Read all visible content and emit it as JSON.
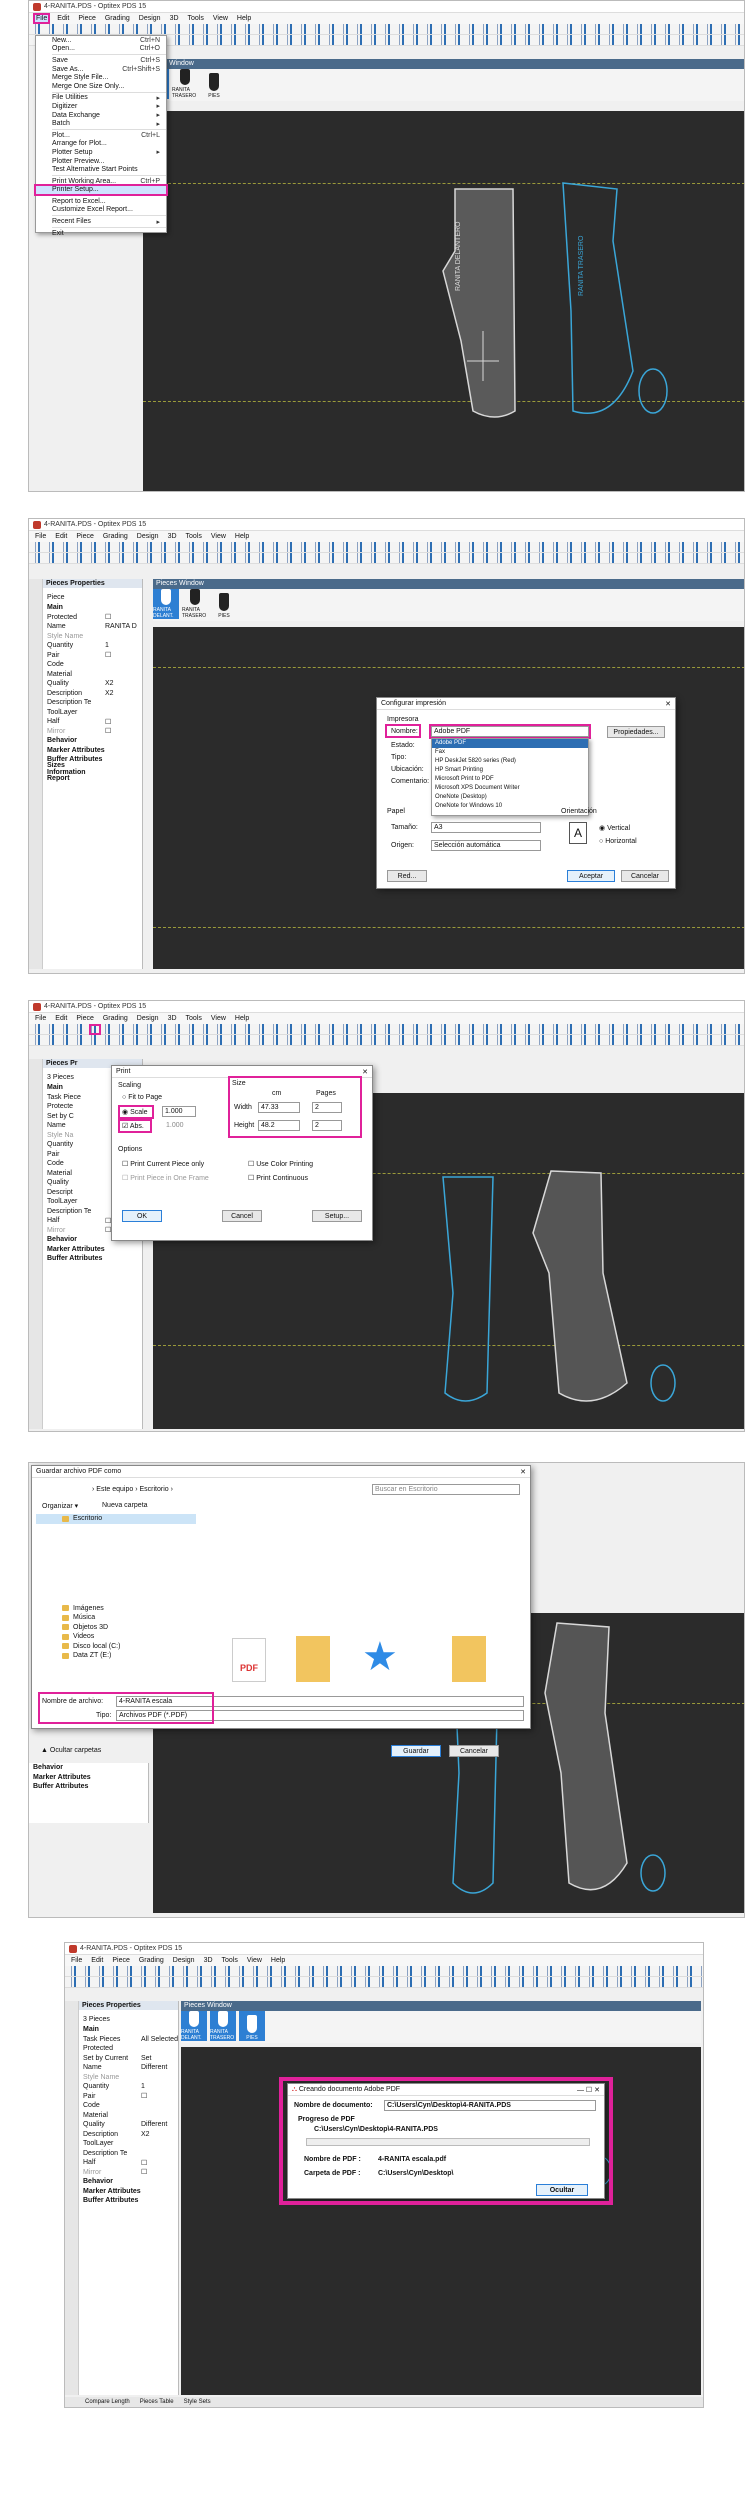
{
  "app_title": "4-RANITA.PDS - Optitex PDS 15",
  "menubar": [
    "File",
    "Edit",
    "Piece",
    "Grading",
    "Design",
    "3D",
    "Tools",
    "View",
    "Help"
  ],
  "pieces_window": "Pieces Window",
  "piece_labels": {
    "delantero": "RANITA DELANTERO",
    "trasero": "RANITA TRASERO"
  },
  "thumbs": [
    "RANITA DELANT.",
    "RANITA TRASERO",
    "PIES"
  ],
  "side_tabs": [
    "Slider",
    "Model Manager",
    "3D Properties"
  ],
  "file_menu": [
    {
      "label": "New...",
      "sc": "Ctrl+N"
    },
    {
      "label": "Open...",
      "sc": "Ctrl+O"
    },
    {
      "label": "Save",
      "sc": "Ctrl+S"
    },
    {
      "label": "Save As...",
      "sc": "Ctrl+Shift+S"
    },
    {
      "label": "Merge Style File...",
      "sc": ""
    },
    {
      "label": "Merge One Size Only...",
      "sc": ""
    },
    {
      "label": "File Utilities",
      "sc": "▸"
    },
    {
      "label": "Digitizer",
      "sc": "▸"
    },
    {
      "label": "Data Exchange",
      "sc": "▸"
    },
    {
      "label": "Batch",
      "sc": "▸"
    },
    {
      "label": "Plot...",
      "sc": "Ctrl+L"
    },
    {
      "label": "Arrange for Plot...",
      "sc": ""
    },
    {
      "label": "Plotter Setup",
      "sc": "▸"
    },
    {
      "label": "Plotter Preview...",
      "sc": ""
    },
    {
      "label": "Test Alternative Start Points",
      "sc": ""
    },
    {
      "label": "Print Working Area...",
      "sc": "Ctrl+P"
    },
    {
      "label": "Printer Setup...",
      "sc": ""
    },
    {
      "label": "Report to Excel...",
      "sc": ""
    },
    {
      "label": "Customize Excel Report...",
      "sc": ""
    },
    {
      "label": "Recent Files",
      "sc": "▸"
    },
    {
      "label": "Exit",
      "sc": ""
    }
  ],
  "props1": {
    "title": "Pieces Properties",
    "section": "Piece",
    "rows": [
      {
        "k": "Main",
        "v": "",
        "t": "b"
      },
      {
        "k": "Protected",
        "v": "☐",
        "t": ""
      },
      {
        "k": "Name",
        "v": "RANITA D",
        "t": ""
      },
      {
        "k": "Style Name",
        "v": "",
        "t": "g"
      },
      {
        "k": "Quantity",
        "v": "1",
        "t": ""
      },
      {
        "k": "Pair",
        "v": "☐",
        "t": ""
      },
      {
        "k": "Code",
        "v": "",
        "t": ""
      },
      {
        "k": "Material",
        "v": "",
        "t": ""
      },
      {
        "k": "Quality",
        "v": "X2",
        "t": ""
      },
      {
        "k": "Description",
        "v": "X2",
        "t": ""
      },
      {
        "k": "Description Te",
        "v": "",
        "t": ""
      },
      {
        "k": "ToolLayer",
        "v": "",
        "t": ""
      },
      {
        "k": "Half",
        "v": "☐",
        "t": ""
      },
      {
        "k": "Mirror",
        "v": "☐",
        "t": "g"
      },
      {
        "k": "Behavior",
        "v": "",
        "t": "b"
      },
      {
        "k": "Marker Attributes",
        "v": "",
        "t": "b"
      },
      {
        "k": "Buffer Attributes",
        "v": "",
        "t": "b"
      },
      {
        "k": "Sizes Information",
        "v": "",
        "t": "b"
      },
      {
        "k": "Report",
        "v": "",
        "t": "b"
      }
    ]
  },
  "config_dialog": {
    "title": "Configurar impresión",
    "group_printer": "Impresora",
    "name_label": "Nombre:",
    "name_value": "Adobe PDF",
    "status_label": "Estado:",
    "type_label": "Tipo:",
    "location_label": "Ubicación:",
    "comment_label": "Comentario:",
    "properties_button": "Propiedades...",
    "printer_list": [
      "Adobe PDF",
      "Fax",
      "HP DeskJet 5820 series (Red)",
      "HP Smart Printing",
      "Microsoft Print to PDF",
      "Microsoft XPS Document Writer",
      "OneNote (Desktop)",
      "OneNote for Windows 10"
    ],
    "group_paper": "Papel",
    "size_label": "Tamaño:",
    "size_value": "A3",
    "source_label": "Origen:",
    "source_value": "Selección automática",
    "orientation": "Orientación",
    "vertical": "Vertical",
    "horizontal": "Horizontal",
    "red_button": "Red...",
    "accept": "Aceptar",
    "cancel": "Cancelar"
  },
  "props3": {
    "title": "Pieces Pr",
    "section": "3 Pieces",
    "rows": [
      {
        "k": "Main",
        "v": "",
        "t": "b"
      },
      {
        "k": "Task Piece",
        "v": "",
        "t": ""
      },
      {
        "k": "Protecte",
        "v": "",
        "t": ""
      },
      {
        "k": "Set by C",
        "v": "",
        "t": ""
      },
      {
        "k": "Name",
        "v": "",
        "t": ""
      },
      {
        "k": "Style Na",
        "v": "",
        "t": "g"
      },
      {
        "k": "Quantity",
        "v": "",
        "t": ""
      },
      {
        "k": "Pair",
        "v": "",
        "t": ""
      },
      {
        "k": "Code",
        "v": "",
        "t": ""
      },
      {
        "k": "Material",
        "v": "",
        "t": ""
      },
      {
        "k": "Quality",
        "v": "",
        "t": ""
      },
      {
        "k": "Descript",
        "v": "",
        "t": ""
      },
      {
        "k": "ToolLayer",
        "v": "",
        "t": ""
      },
      {
        "k": "Description Te",
        "v": "",
        "t": ""
      },
      {
        "k": "Half",
        "v": "☐",
        "t": ""
      },
      {
        "k": "Mirror",
        "v": "☐",
        "t": "g"
      },
      {
        "k": "Behavior",
        "v": "",
        "t": "b"
      },
      {
        "k": "Marker Attributes",
        "v": "",
        "t": "b"
      },
      {
        "k": "Buffer Attributes",
        "v": "",
        "t": "b"
      }
    ]
  },
  "print_dialog": {
    "title": "Print",
    "scaling": "Scaling",
    "fit": "Fit to Page",
    "scale": "Scale",
    "scale_value": "1.000",
    "abs": "Abs.",
    "abs_value": "1.000",
    "size": "Size",
    "cm": "cm",
    "pages": "Pages",
    "width_label": "Width",
    "width_value": "47.33",
    "width_pages": "2",
    "height_label": "Height",
    "height_value": "48.2",
    "height_pages": "2",
    "options": "Options",
    "opt1": "Print Current Piece only",
    "opt2": "Print Piece in One Frame",
    "opt3": "Use Color Printing",
    "opt4": "Print Continuous",
    "ok": "OK",
    "cancel": "Cancel",
    "setup": "Setup..."
  },
  "save_dialog": {
    "title": "Guardar archivo PDF como",
    "path": [
      "Este equipo",
      "Escritorio"
    ],
    "search": "Buscar en Escritorio",
    "organize": "Organizar ▾",
    "new_folder": "Nueva carpeta",
    "tree": [
      "Escritorio",
      "Imágenes",
      "Música",
      "Objetos 3D",
      "Videos",
      "Disco local (C:)",
      "Data ZT (E:)"
    ],
    "filename_label": "Nombre de archivo:",
    "filename_value": "4-RANITA escala",
    "type_label": "Tipo:",
    "type_value": "Archivos PDF (*.PDF)",
    "hide_folders": "Ocultar carpetas",
    "save": "Guardar",
    "cancel": "Cancelar",
    "pdf_icon_text": "PDF"
  },
  "props4": [
    {
      "k": "Behavior",
      "t": "b"
    },
    {
      "k": "Marker Attributes",
      "t": "b"
    },
    {
      "k": "Buffer Attributes",
      "t": "b"
    }
  ],
  "props5": {
    "title": "Pieces Properties",
    "section": "3 Pieces",
    "rows": [
      {
        "k": "Main",
        "v": "",
        "t": "b"
      },
      {
        "k": "Task Pieces",
        "v": "All Selected",
        "t": ""
      },
      {
        "k": "Protected",
        "v": "",
        "t": ""
      },
      {
        "k": "Set by Current",
        "v": "Set",
        "t": ""
      },
      {
        "k": "Name",
        "v": "Different",
        "t": ""
      },
      {
        "k": "Style Name",
        "v": "",
        "t": "g"
      },
      {
        "k": "Quantity",
        "v": "1",
        "t": ""
      },
      {
        "k": "Pair",
        "v": "☐",
        "t": ""
      },
      {
        "k": "Code",
        "v": "",
        "t": ""
      },
      {
        "k": "Material",
        "v": "",
        "t": ""
      },
      {
        "k": "Quality",
        "v": "Different",
        "t": ""
      },
      {
        "k": "Description",
        "v": "X2",
        "t": ""
      },
      {
        "k": "ToolLayer",
        "v": "",
        "t": ""
      },
      {
        "k": "Description Te",
        "v": "",
        "t": ""
      },
      {
        "k": "Half",
        "v": "☐",
        "t": ""
      },
      {
        "k": "Mirror",
        "v": "☐",
        "t": "g"
      },
      {
        "k": "Behavior",
        "v": "",
        "t": "b"
      },
      {
        "k": "Marker Attributes",
        "v": "",
        "t": "b"
      },
      {
        "k": "Buffer Attributes",
        "v": "",
        "t": "b"
      }
    ]
  },
  "creating_dialog": {
    "title": "Creando documento Adobe PDF",
    "doc_label": "Nombre de documento:",
    "doc_value": "C:\\Users\\Cyn\\Desktop\\4-RANITA.PDS",
    "progress_label": "Progreso de PDF",
    "progress_path": "C:\\Users\\Cyn\\Desktop\\4-RANITA.PDS",
    "pdfname_label": "Nombre de PDF :",
    "pdfname_value": "4-RANITA escala.pdf",
    "folder_label": "Carpeta de PDF :",
    "folder_value": "C:\\Users\\Cyn\\Desktop\\",
    "hide_button": "Ocultar"
  },
  "status5": [
    "Compare Length",
    "Pieces Table",
    "Style Sets"
  ],
  "colors": {
    "highlight": "#e0219a",
    "canvas": "#2b2b2b",
    "piece_white": "#d8d8d8",
    "piece_blue": "#3aa6d8"
  }
}
